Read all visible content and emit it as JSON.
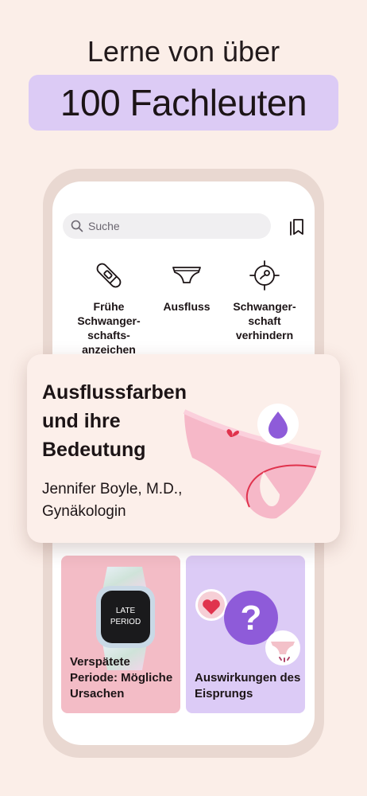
{
  "promo": {
    "headline": "Lerne von über",
    "highlight": "100 Fachleuten"
  },
  "search": {
    "placeholder": "Suche"
  },
  "categories": [
    {
      "label": "Frühe Schwanger­schafts­anzeichen",
      "icon": "pregnancy-test-icon"
    },
    {
      "label": "Ausfluss",
      "icon": "underwear-icon"
    },
    {
      "label": "Schwanger­schaft verhindern",
      "icon": "sperm-target-icon"
    }
  ],
  "feature": {
    "title": "Ausflussfarben und ihre Bedeutung",
    "author": "Jennifer Boyle, M.D., Gynäkologin"
  },
  "tiles": [
    {
      "label": "Verspätete Periode: Mögliche Ursachen",
      "watch_text_1": "LATE",
      "watch_text_2": "PERIOD"
    },
    {
      "label": "Auswirkungen des Eisprungs"
    }
  ],
  "colors": {
    "background": "#fbeee8",
    "highlight": "#dccbf5",
    "tile_pink": "#f3bcc6",
    "tile_purple": "#dccbf6",
    "accent_purple": "#8e5bd9"
  }
}
